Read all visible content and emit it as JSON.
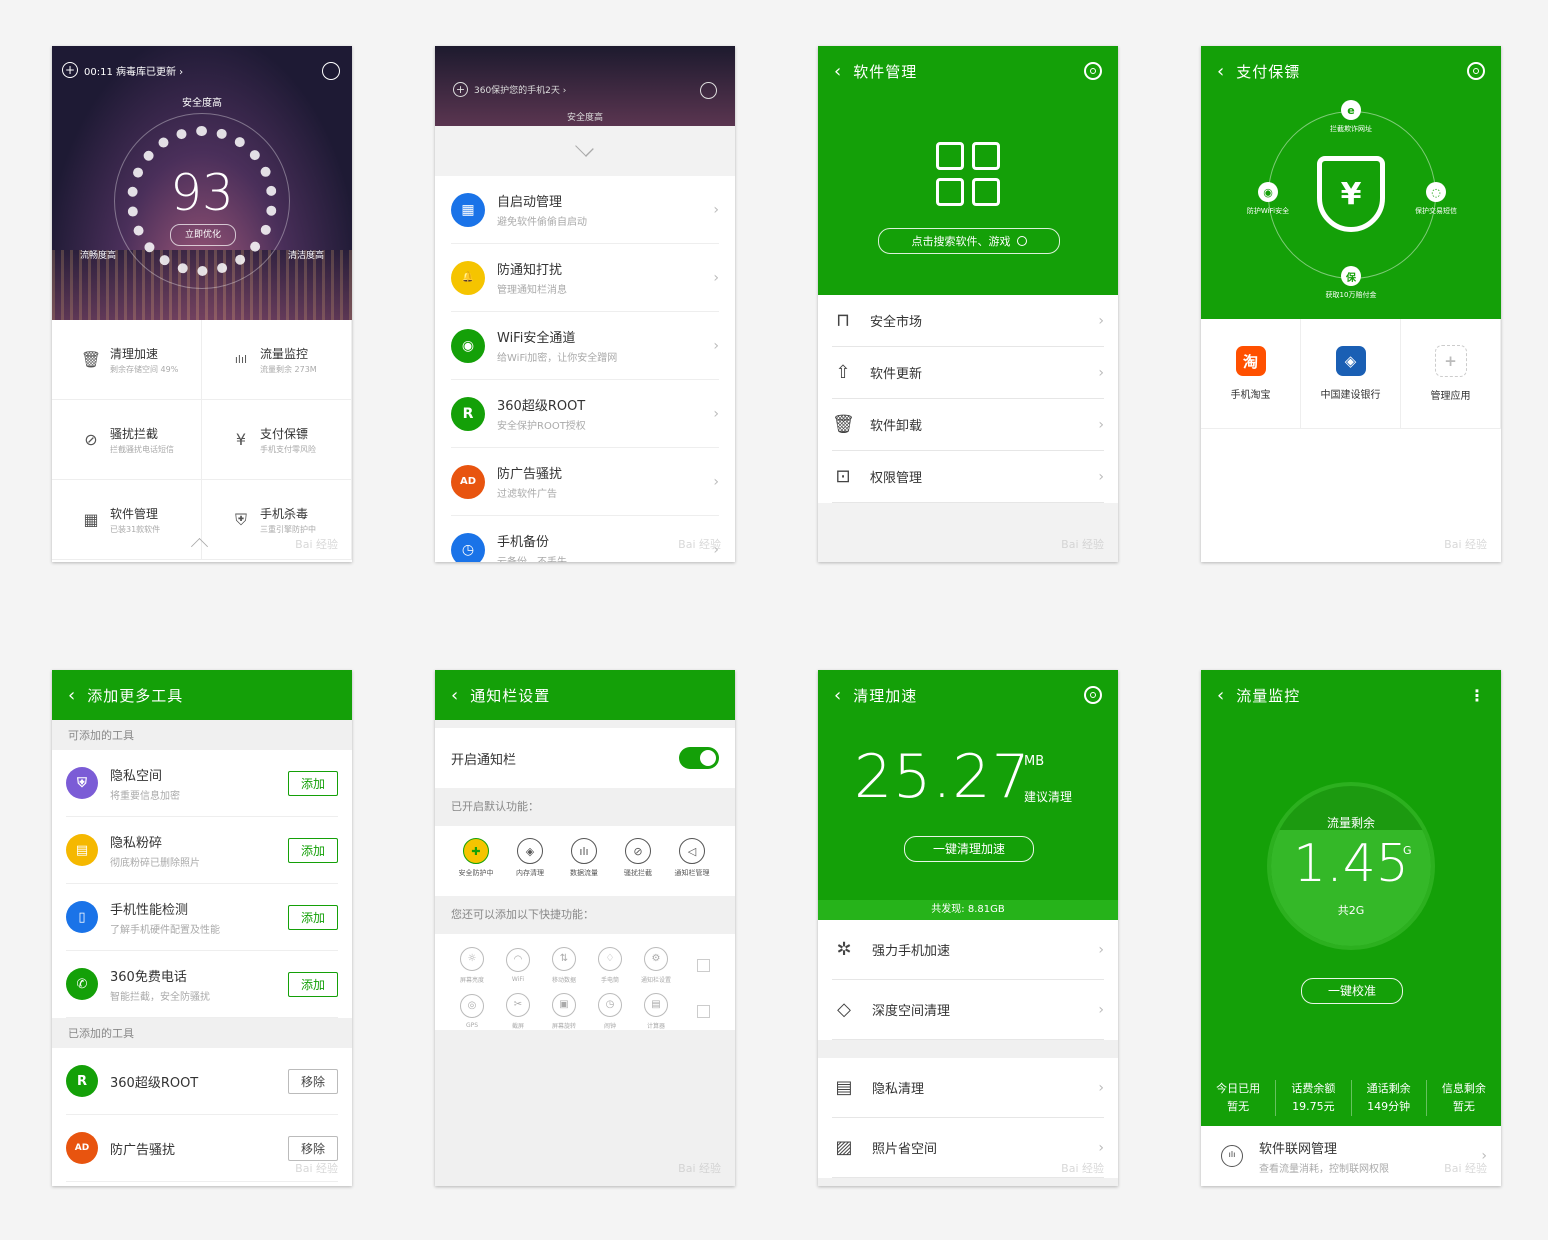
{
  "p1": {
    "header_text": "00:11 病毒库已更新 ›",
    "safety": "安全度高",
    "score": "93",
    "optimize": "立即优化",
    "fluency": "流畅度高",
    "clean": "清洁度高",
    "tiles": [
      {
        "icon": "trash-icon",
        "title": "清理加速",
        "sub": "剩余存储空间 49%"
      },
      {
        "icon": "bar-chart-icon",
        "title": "流量监控",
        "sub": "流量剩余 273M"
      },
      {
        "icon": "block-icon",
        "title": "骚扰拦截",
        "sub": "拦截骚扰电话短信"
      },
      {
        "icon": "yen-shield-icon",
        "title": "支付保镖",
        "sub": "手机支付零风险"
      },
      {
        "icon": "grid-icon",
        "title": "软件管理",
        "sub": "已装31款软件"
      },
      {
        "icon": "shield-icon",
        "title": "手机杀毒",
        "sub": "三重引擎防护中"
      }
    ],
    "tile_glyphs": [
      "🗑",
      "ılıl",
      "⊘",
      "¥",
      "▦",
      "⛨"
    ]
  },
  "p2": {
    "header_text": "360保护您的手机2天 ›",
    "safety": "安全度高",
    "items": [
      {
        "title": "自启动管理",
        "sub": "避免软件偷偷自启动",
        "color": "#1a73e8",
        "glyph": "▦"
      },
      {
        "title": "防通知打扰",
        "sub": "管理通知栏消息",
        "color": "#f5c400",
        "glyph": "🔔"
      },
      {
        "title": "WiFi安全通道",
        "sub": "给WiFi加密，让你安全蹭网",
        "color": "#14a008",
        "glyph": "◉"
      },
      {
        "title": "360超级ROOT",
        "sub": "安全保护ROOT授权",
        "color": "#14a008",
        "glyph": "R"
      },
      {
        "title": "防广告骚扰",
        "sub": "过滤软件广告",
        "color": "#e8540f",
        "glyph": "AD"
      },
      {
        "title": "手机备份",
        "sub": "云备份，不丢失",
        "color": "#1a73e8",
        "glyph": "◷"
      }
    ]
  },
  "p3": {
    "title": "软件管理",
    "search": "点击搜索软件、游戏",
    "items": [
      {
        "label": "安全市场",
        "glyph": "⊓"
      },
      {
        "label": "软件更新",
        "glyph": "⇧"
      },
      {
        "label": "软件卸载",
        "glyph": "🗑"
      },
      {
        "label": "权限管理",
        "glyph": "⊡"
      }
    ]
  },
  "p4": {
    "title": "支付保镖",
    "orbit": [
      {
        "label": "拦截欺诈网址",
        "glyph": "e"
      },
      {
        "label": "防护WiFi安全",
        "glyph": "◉"
      },
      {
        "label": "保护交易短信",
        "glyph": "◌"
      },
      {
        "label": "获取10万赔付金",
        "glyph": "保"
      }
    ],
    "apps": [
      {
        "label": "手机淘宝",
        "color": "#ff5000",
        "glyph": "淘"
      },
      {
        "label": "中国建设银行",
        "color": "#1a5fb4",
        "glyph": "◈"
      },
      {
        "label": "管理应用",
        "color": "#cccccc",
        "glyph": "+"
      }
    ]
  },
  "p5": {
    "title": "添加更多工具",
    "section_available": "可添加的工具",
    "section_added": "已添加的工具",
    "add_label": "添加",
    "remove_label": "移除",
    "available": [
      {
        "title": "隐私空间",
        "sub": "将重要信息加密",
        "color": "#7b5cd6",
        "glyph": "⛨"
      },
      {
        "title": "隐私粉碎",
        "sub": "彻底粉碎已删除照片",
        "color": "#f5b800",
        "glyph": "▤"
      },
      {
        "title": "手机性能检测",
        "sub": "了解手机硬件配置及性能",
        "color": "#1a73e8",
        "glyph": "▯"
      },
      {
        "title": "360免费电话",
        "sub": "智能拦截，安全防骚扰",
        "color": "#14a008",
        "glyph": "✆"
      }
    ],
    "added": [
      {
        "title": "360超级ROOT",
        "color": "#14a008",
        "glyph": "R"
      },
      {
        "title": "防广告骚扰",
        "color": "#e8540f",
        "glyph": "AD"
      }
    ]
  },
  "p6": {
    "title": "通知栏设置",
    "toggle_label": "开启通知栏",
    "toggle_on": true,
    "enabled_section": "已开启默认功能：",
    "enabled": [
      {
        "label": "安全防护中",
        "glyph": "✚"
      },
      {
        "label": "内存清理",
        "glyph": "◈"
      },
      {
        "label": "数据流量",
        "glyph": "ılı"
      },
      {
        "label": "骚扰拦截",
        "glyph": "⊘"
      },
      {
        "label": "通知栏管理",
        "glyph": "◁"
      }
    ],
    "more_section": "您还可以添加以下快捷功能：",
    "row1": [
      {
        "label": "屏幕亮度",
        "glyph": "☼"
      },
      {
        "label": "WiFi",
        "glyph": "◠"
      },
      {
        "label": "移动数据",
        "glyph": "⇅"
      },
      {
        "label": "手电筒",
        "glyph": "♢"
      },
      {
        "label": "通知栏设置",
        "glyph": "⚙"
      }
    ],
    "row2": [
      {
        "label": "GPS",
        "glyph": "◎"
      },
      {
        "label": "截屏",
        "glyph": "✂"
      },
      {
        "label": "屏幕旋转",
        "glyph": "▣"
      },
      {
        "label": "闹钟",
        "glyph": "◷"
      },
      {
        "label": "计算器",
        "glyph": "▤"
      }
    ]
  },
  "p7": {
    "title": "清理加速",
    "size": "25.27",
    "unit": "MB",
    "advice": "建议清理",
    "button": "一键清理加速",
    "found": "共发现: 8.81GB",
    "group1": [
      {
        "label": "强力手机加速",
        "glyph": "✲"
      },
      {
        "label": "深度空间清理",
        "glyph": "◇"
      }
    ],
    "group2": [
      {
        "label": "隐私清理",
        "glyph": "▤"
      },
      {
        "label": "照片省空间",
        "glyph": "▨"
      }
    ]
  },
  "p8": {
    "title": "流量监控",
    "remaining_label": "流量剩余",
    "remaining": "1.45",
    "unit": "G",
    "total": "共2G",
    "calibrate": "一键校准",
    "stats": [
      {
        "label": "今日已用",
        "value": "暂无"
      },
      {
        "label": "话费余额",
        "value": "19.75元"
      },
      {
        "label": "通话剩余",
        "value": "149分钟"
      },
      {
        "label": "信息剩余",
        "value": "暂无"
      }
    ],
    "footer_title": "软件联网管理",
    "footer_sub": "查看流量消耗，控制联网权限"
  },
  "watermark": "Bai 经验"
}
